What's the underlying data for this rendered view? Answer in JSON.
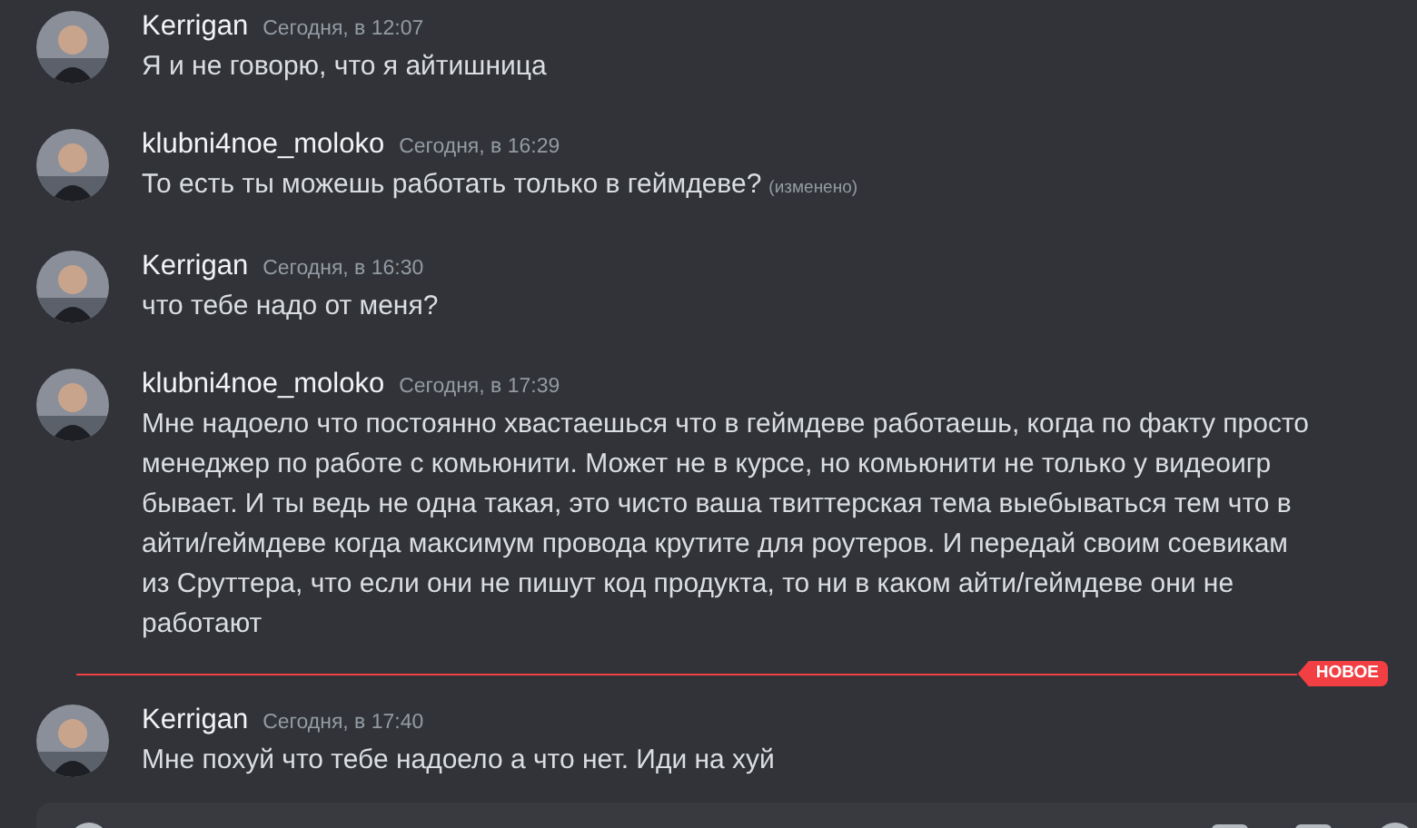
{
  "messages": [
    {
      "kind": "message",
      "author": "Kerrigan",
      "timestamp": "Сегодня, в 12:07",
      "text": "Я и не говорю, что я айтишница"
    },
    {
      "kind": "message",
      "author": "klubni4noe_moloko",
      "timestamp": "Сегодня, в 16:29",
      "text": "То есть ты можешь работать только в геймдеве?",
      "edited": "(изменено)"
    },
    {
      "kind": "message",
      "author": "Kerrigan",
      "timestamp": "Сегодня, в 16:30",
      "text": "что тебе надо от меня?"
    },
    {
      "kind": "message",
      "author": "klubni4noe_moloko",
      "timestamp": "Сегодня, в 17:39",
      "text": "Мне надоело что постоянно хвастаешься что в геймдеве работаешь, когда по факту просто менеджер по работе с комьюнити. Может не в курсе, но комьюнити не только у видеоигр бывает. И ты ведь не одна такая, это чисто ваша твиттерская тема выебываться тем что в айти/геймдеве когда максимум провода крутите для роутеров. И передай своим соевикам из Сруттера, что если они не пишут код продукта, то ни в каком айти/геймдеве они не работают"
    },
    {
      "kind": "divider",
      "label": "НОВОЕ"
    },
    {
      "kind": "message",
      "author": "Kerrigan",
      "timestamp": "Сегодня, в 17:40",
      "text": "Мне похуй что тебе надоело а что нет. Иди на хуй"
    }
  ]
}
